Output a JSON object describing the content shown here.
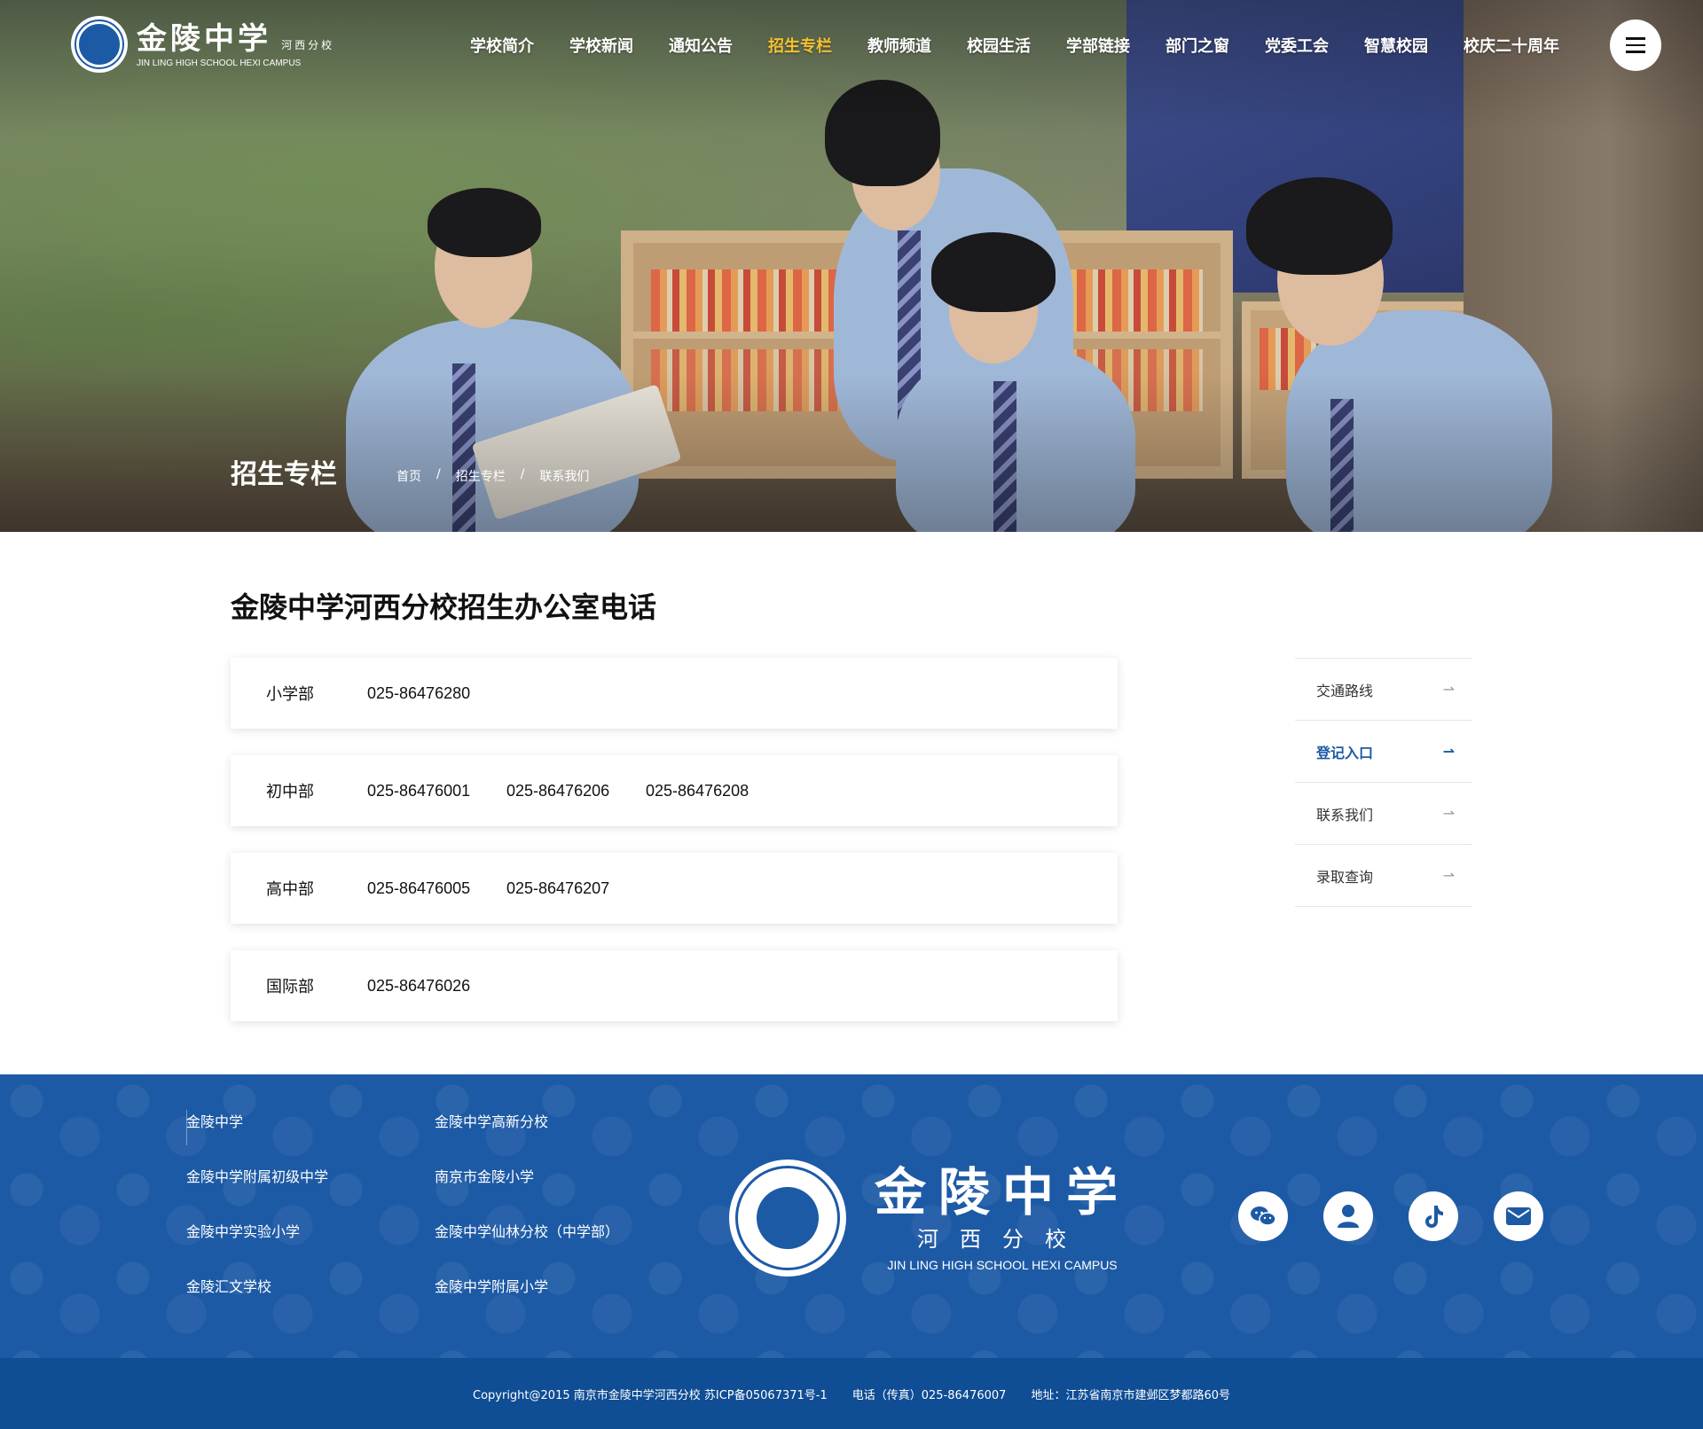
{
  "header": {
    "logo_cn": "金陵中学",
    "logo_sub": "河西分校",
    "logo_en": "JIN LING HIGH SCHOOL HEXI CAMPUS",
    "nav": [
      "学校简介",
      "学校新闻",
      "通知公告",
      "招生专栏",
      "教师频道",
      "校园生活",
      "学部链接",
      "部门之窗",
      "党委工会",
      "智慧校园",
      "校庆二十周年"
    ],
    "active_nav_index": 3,
    "active_color": "#f5c02e"
  },
  "banner": {
    "title": "招生专栏",
    "breadcrumb": [
      "首页",
      "招生专栏",
      "联系我们"
    ],
    "separator": "/"
  },
  "main": {
    "title": "金陵中学河西分校招生办公室电话",
    "departments": [
      {
        "name": "小学部",
        "phones": [
          "025-86476280"
        ]
      },
      {
        "name": "初中部",
        "phones": [
          "025-86476001",
          "025-86476206",
          "025-86476208"
        ]
      },
      {
        "name": "高中部",
        "phones": [
          "025-86476005",
          "025-86476207"
        ]
      },
      {
        "name": "国际部",
        "phones": [
          "025-86476026"
        ]
      }
    ]
  },
  "sidebar": {
    "items": [
      {
        "label": "交通路线",
        "arrow": "⇀"
      },
      {
        "label": "登记入口",
        "arrow": "⇀"
      },
      {
        "label": "联系我们",
        "arrow": "⇀"
      },
      {
        "label": "录取查询",
        "arrow": "⇀"
      }
    ],
    "active_index": 1,
    "accent": "#1c5aa6"
  },
  "footer": {
    "links_col1": [
      "金陵中学",
      "金陵中学附属初级中学",
      "金陵中学实验小学",
      "金陵汇文学校"
    ],
    "links_col2": [
      "金陵中学高新分校",
      "南京市金陵小学",
      "金陵中学仙林分校（中学部）",
      "金陵中学附属小学"
    ],
    "logo_cn": "金陵中学",
    "logo_sub": "河西分校",
    "logo_en": "JIN LING HIGH SCHOOL HEXI CAMPUS",
    "socials": [
      "wechat-icon",
      "user-icon",
      "tiktok-icon",
      "mail-icon"
    ],
    "copyright": "Copyright@2015 南京市金陵中学河西分校  苏ICP备05067371号-1",
    "phone": "电话（传真）025-86476007",
    "address": "地址：江苏省南京市建邺区梦都路60号",
    "bg_color": "#1d5aa5"
  }
}
